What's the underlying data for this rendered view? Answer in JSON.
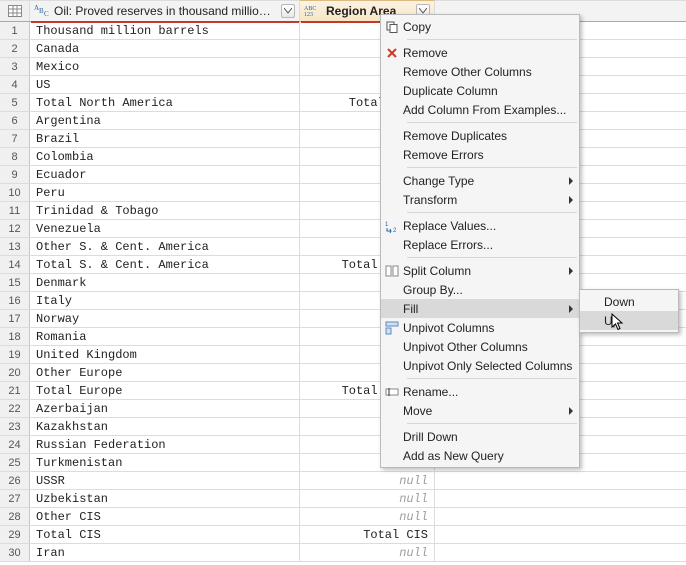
{
  "columns": {
    "a": {
      "title": "Oil: Proved reserves in thousand million barrels",
      "type_icon": "ABC"
    },
    "b": {
      "title": "Region Area",
      "type_icon": "123"
    }
  },
  "rows": [
    {
      "n": "1",
      "a": "Thousand million barrels",
      "b": ""
    },
    {
      "n": "2",
      "a": "Canada",
      "b": ""
    },
    {
      "n": "3",
      "a": "Mexico",
      "b": ""
    },
    {
      "n": "4",
      "a": "US",
      "b": ""
    },
    {
      "n": "5",
      "a": "Total North America",
      "b": "Total North"
    },
    {
      "n": "6",
      "a": "Argentina",
      "b": ""
    },
    {
      "n": "7",
      "a": "Brazil",
      "b": ""
    },
    {
      "n": "8",
      "a": "Colombia",
      "b": ""
    },
    {
      "n": "9",
      "a": "Ecuador",
      "b": ""
    },
    {
      "n": "10",
      "a": "Peru",
      "b": ""
    },
    {
      "n": "11",
      "a": "Trinidad & Tobago",
      "b": ""
    },
    {
      "n": "12",
      "a": "Venezuela",
      "b": ""
    },
    {
      "n": "13",
      "a": "Other S. & Cent. America",
      "b": ""
    },
    {
      "n": "14",
      "a": "Total S. & Cent. America",
      "b": "Total S. & C"
    },
    {
      "n": "15",
      "a": "Denmark",
      "b": ""
    },
    {
      "n": "16",
      "a": "Italy",
      "b": ""
    },
    {
      "n": "17",
      "a": "Norway",
      "b": ""
    },
    {
      "n": "18",
      "a": "Romania",
      "b": ""
    },
    {
      "n": "19",
      "a": "United Kingdom",
      "b": ""
    },
    {
      "n": "20",
      "a": "Other Europe",
      "b": ""
    },
    {
      "n": "21",
      "a": "Total Europe",
      "b": "Total Europe"
    },
    {
      "n": "22",
      "a": "Azerbaijan",
      "b": ""
    },
    {
      "n": "23",
      "a": "Kazakhstan",
      "b": ""
    },
    {
      "n": "24",
      "a": "Russian Federation",
      "b": ""
    },
    {
      "n": "25",
      "a": "Turkmenistan",
      "b": "null"
    },
    {
      "n": "26",
      "a": "USSR",
      "b": "null"
    },
    {
      "n": "27",
      "a": "Uzbekistan",
      "b": "null"
    },
    {
      "n": "28",
      "a": "Other CIS",
      "b": "null"
    },
    {
      "n": "29",
      "a": "Total CIS",
      "b": "Total CIS"
    },
    {
      "n": "30",
      "a": "Iran",
      "b": "null"
    }
  ],
  "menu": {
    "items": [
      {
        "kind": "item",
        "label": "Copy",
        "icon": "copy"
      },
      {
        "kind": "sep"
      },
      {
        "kind": "item",
        "label": "Remove",
        "icon": "delete"
      },
      {
        "kind": "item",
        "label": "Remove Other Columns"
      },
      {
        "kind": "item",
        "label": "Duplicate Column"
      },
      {
        "kind": "item",
        "label": "Add Column From Examples..."
      },
      {
        "kind": "sep"
      },
      {
        "kind": "item",
        "label": "Remove Duplicates"
      },
      {
        "kind": "item",
        "label": "Remove Errors"
      },
      {
        "kind": "sep"
      },
      {
        "kind": "item",
        "label": "Change Type",
        "sub": true
      },
      {
        "kind": "item",
        "label": "Transform",
        "sub": true
      },
      {
        "kind": "sep"
      },
      {
        "kind": "item",
        "label": "Replace Values...",
        "icon": "replace"
      },
      {
        "kind": "item",
        "label": "Replace Errors..."
      },
      {
        "kind": "sep"
      },
      {
        "kind": "item",
        "label": "Split Column",
        "icon": "split",
        "sub": true
      },
      {
        "kind": "item",
        "label": "Group By..."
      },
      {
        "kind": "item",
        "label": "Fill",
        "sub": true,
        "hovered": true
      },
      {
        "kind": "item",
        "label": "Unpivot Columns",
        "icon": "unpivot"
      },
      {
        "kind": "item",
        "label": "Unpivot Other Columns"
      },
      {
        "kind": "item",
        "label": "Unpivot Only Selected Columns"
      },
      {
        "kind": "sep"
      },
      {
        "kind": "item",
        "label": "Rename...",
        "icon": "rename"
      },
      {
        "kind": "item",
        "label": "Move",
        "sub": true
      },
      {
        "kind": "sep"
      },
      {
        "kind": "item",
        "label": "Drill Down"
      },
      {
        "kind": "item",
        "label": "Add as New Query"
      }
    ]
  },
  "submenu": {
    "items": [
      {
        "label": "Down"
      },
      {
        "label": "Up",
        "hovered": true
      }
    ]
  }
}
